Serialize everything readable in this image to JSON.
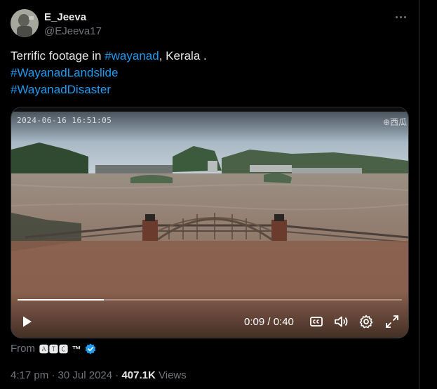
{
  "author": {
    "display_name": "E_Jeeva",
    "handle": "@EJeeva17",
    "avatar_icon": "user-avatar"
  },
  "more_icon": "more-horizontal-icon",
  "tweet": {
    "text_prefix": "Terrific footage in ",
    "hashtag_1": "#wayanad",
    "text_suffix": ", Kerala .",
    "hashtag_2": "#WayanadLandslide",
    "hashtag_3": "#WayanadDisaster"
  },
  "video": {
    "overlay_timestamp": "2024-06-16  16:51:05",
    "watermark": "⊕西瓜",
    "current_time": "0:09",
    "duration": "0:40",
    "progress_fraction": 0.225,
    "time_display": "0:09 / 0:40",
    "icons": [
      "play-icon",
      "captions-icon",
      "volume-icon",
      "settings-icon",
      "fullscreen-icon"
    ]
  },
  "from": {
    "label": "From",
    "source": "🅰🆃🅲 ™"
  },
  "meta": {
    "time": "4:17 pm",
    "separator": "·",
    "date": "30 Jul 2024",
    "views_count": "407.1K",
    "views_label": "Views"
  },
  "colors": {
    "background": "#000000",
    "text_primary": "#e7e9ea",
    "text_secondary": "#71767b",
    "link": "#1d9bf0",
    "border": "#2f3336"
  }
}
